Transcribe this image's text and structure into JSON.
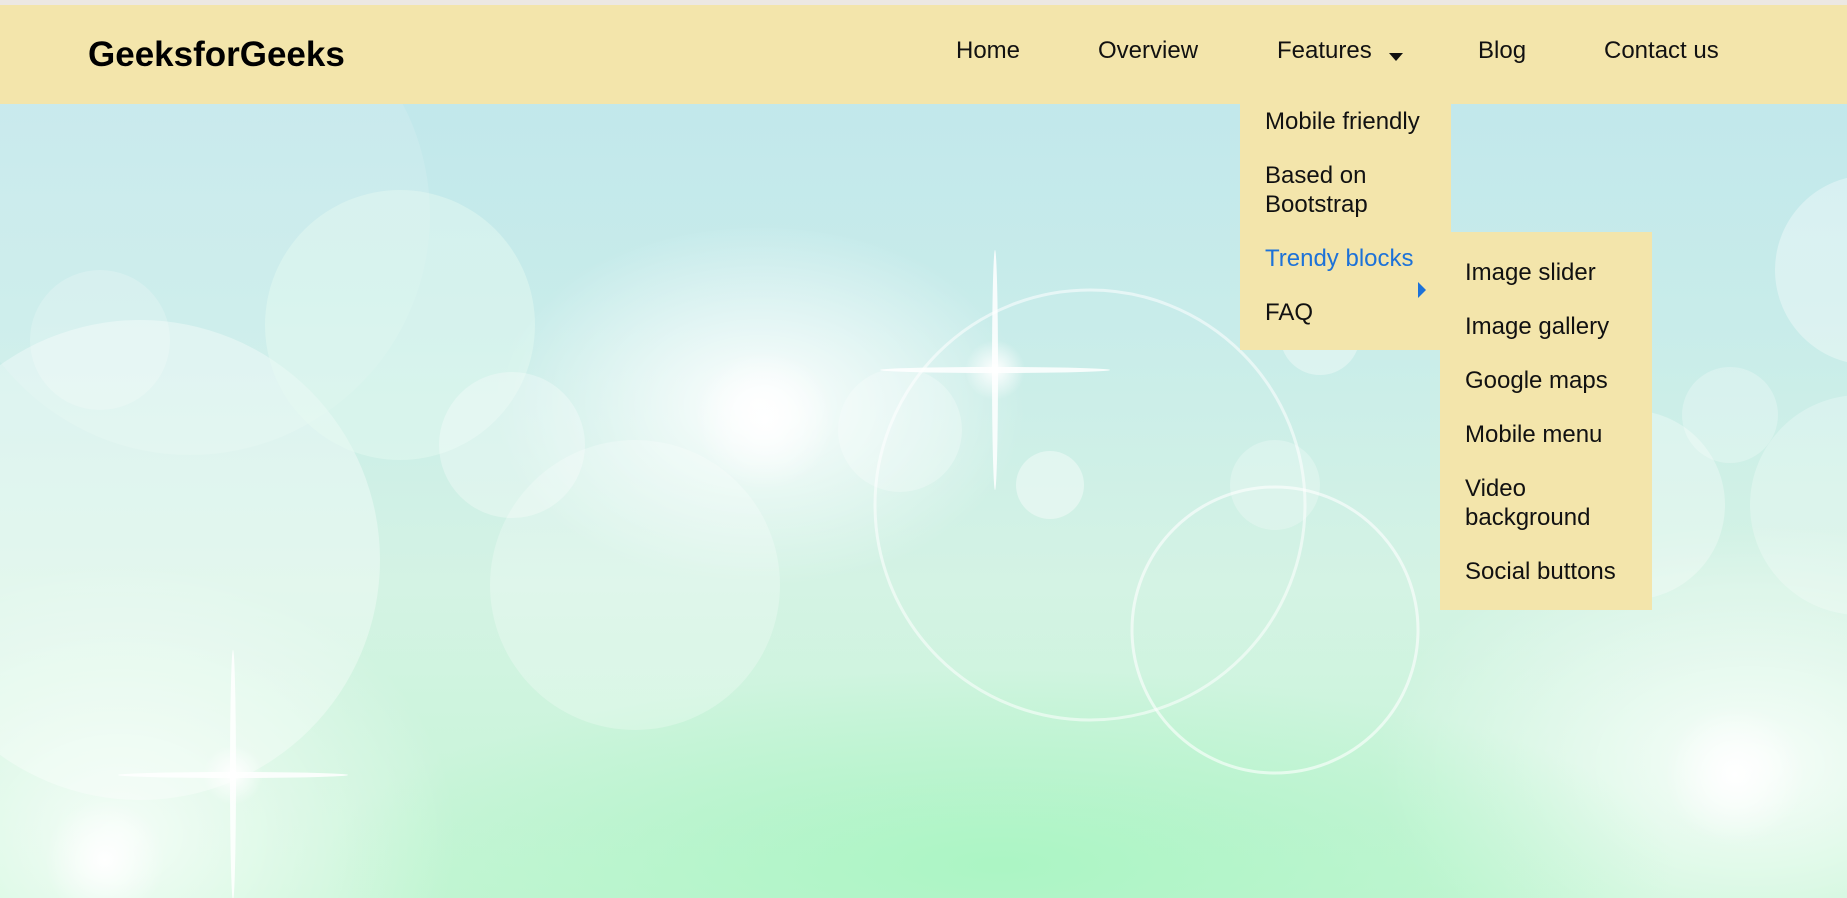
{
  "brand": {
    "name": "GeeksforGeeks"
  },
  "nav": {
    "items": [
      {
        "label": "Home"
      },
      {
        "label": "Overview"
      },
      {
        "label": "Features"
      },
      {
        "label": "Blog"
      },
      {
        "label": "Contact us"
      }
    ]
  },
  "features_dropdown": {
    "items": [
      {
        "label": "Mobile friendly"
      },
      {
        "label": "Based on Bootstrap"
      },
      {
        "label": "Trendy blocks",
        "state": "hover"
      },
      {
        "label": "FAQ"
      }
    ]
  },
  "trendy_blocks_submenu": {
    "items": [
      {
        "label": "Image slider"
      },
      {
        "label": "Image gallery"
      },
      {
        "label": "Google maps"
      },
      {
        "label": "Mobile menu"
      },
      {
        "label": "Video background"
      },
      {
        "label": "Social buttons"
      }
    ]
  },
  "icons": {
    "features_caret": "caret-down-icon",
    "trendy_caret": "caret-right-icon"
  },
  "colors": {
    "navbar_bg": "#f3e5ab",
    "active_link": "#1d72d8",
    "text": "#111111"
  }
}
